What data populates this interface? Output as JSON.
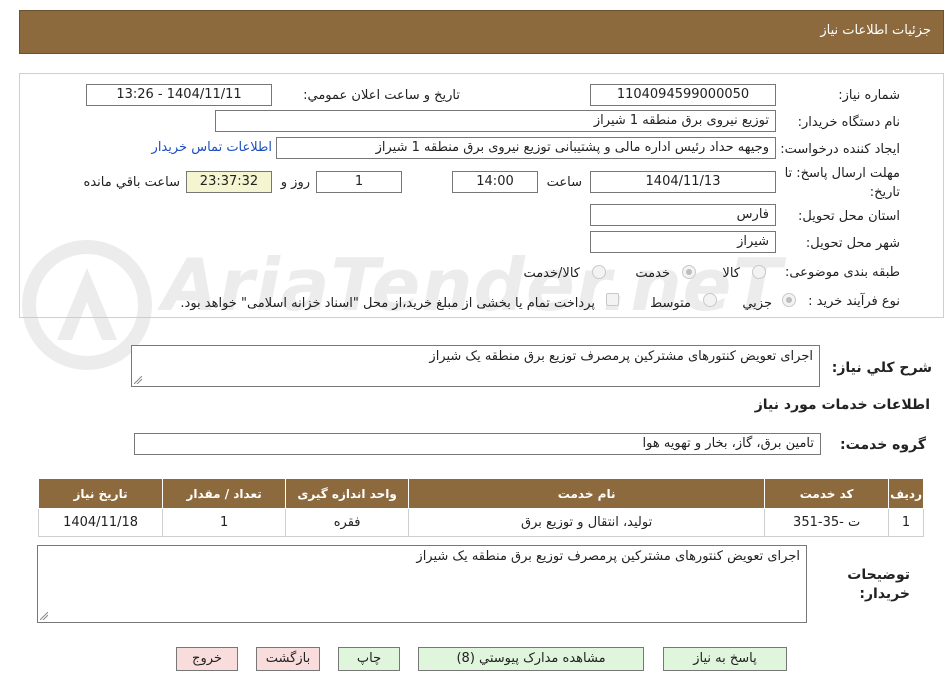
{
  "header": {
    "title": "جزئیات اطلاعات نیاز"
  },
  "form": {
    "need_number_label": "شماره نیاز:",
    "need_number": "1104094599000050",
    "announce_label": "تاریخ و ساعت اعلان عمومي:",
    "announce_value": "1404/11/11 - 13:26",
    "buyer_org_label": "نام دستگاه خريدار:",
    "buyer_org": "توزیع نیروی برق منطقه 1 شیراز",
    "requester_label": "ايجاد کننده درخواست:",
    "requester": "وجیهه حداد رئیس اداره مالی و پشتیبانی توزیع نیروی برق منطقه 1 شیراز",
    "contact_link": "اطلاعات تماس خريدار",
    "deadline_label_1": "مهلت ارسال پاسخ: تا",
    "deadline_label_2": "تاريخ:",
    "deadline_date": "1404/11/13",
    "time_label": "ساعت",
    "deadline_time": "14:00",
    "days_value": "1",
    "days_label": "روز و",
    "remaining_time": "23:37:32",
    "remaining_label": "ساعت باقي مانده",
    "province_label": "استان محل تحويل:",
    "province": "فارس",
    "city_label": "شهر محل تحويل:",
    "city": "شیراز",
    "category_label": "طبقه بندی موضوعی:",
    "category_options": [
      "کالا",
      "خدمت",
      "کالا/خدمت"
    ],
    "category_selected": "خدمت",
    "process_label": "نوع فرآيند خريد :",
    "process_options": [
      "جزيي",
      "متوسط"
    ],
    "process_selected": "جزيي",
    "payment_note": "پرداخت تمام یا بخشی از مبلغ خرید،از محل \"اسناد خزانه اسلامی\" خواهد بود."
  },
  "watermark": {
    "text": "AriaTender.neT"
  },
  "description": {
    "label": "شرح کلي نياز:",
    "value": "اجرای تعویض کنتورهای مشترکین پرمصرف توزیع برق منطقه یک شیراز"
  },
  "services": {
    "title": "اطلاعات خدمات مورد نياز",
    "group_label": "گروه خدمت:",
    "group_value": "تامین برق، گاز، بخار و تهویه هوا",
    "columns": [
      "رديف",
      "کد خدمت",
      "نام خدمت",
      "واحد اندازه گيری",
      "تعداد / مقدار",
      "تاريخ نياز"
    ],
    "rows": [
      {
        "row": "1",
        "code": "ت -35-351",
        "name": "تولید، انتقال و توزیع برق",
        "unit": "فقره",
        "qty": "1",
        "date": "1404/11/18"
      }
    ]
  },
  "buyer_notes": {
    "label_1": "توضيحات",
    "label_2": "خريدار:",
    "value": "اجرای تعویض کنتورهای مشترکین پرمصرف توزیع برق منطقه یک شیراز"
  },
  "buttons": {
    "reply": "پاسخ به نياز",
    "attachments": "مشاهده مدارک پيوستي (8)",
    "print": "چاپ",
    "back": "بازگشت",
    "exit": "خروج"
  },
  "colors": {
    "header_bg": "#8c6a3e",
    "link": "#1d4fbf",
    "timer_bg": "#f6f5d1",
    "button_green": "#dff5dc",
    "button_pink": "#f9dcdc"
  }
}
